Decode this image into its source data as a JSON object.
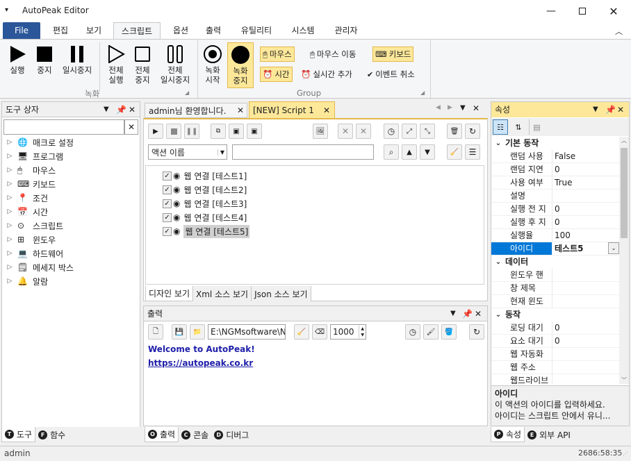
{
  "app": {
    "title": "AutoPeak Editor"
  },
  "ribbon_tabs": [
    {
      "label": "File"
    },
    {
      "label": "편집"
    },
    {
      "label": "보기"
    },
    {
      "label": "스크립트"
    },
    {
      "label": "옵션"
    },
    {
      "label": "출력"
    },
    {
      "label": "유틸리티"
    },
    {
      "label": "시스템"
    },
    {
      "label": "관리자"
    }
  ],
  "ribbon": {
    "record_buttons": [
      {
        "label": "실행"
      },
      {
        "label": "중지"
      },
      {
        "label": "일시중지"
      }
    ],
    "all_buttons": [
      {
        "label": "전체\n실행"
      },
      {
        "label": "전체\n중지"
      },
      {
        "label": "전체\n일시중지"
      }
    ],
    "rec_buttons": [
      {
        "label": "녹화\n시작"
      },
      {
        "label": "녹화\n중지"
      }
    ],
    "group_items": {
      "mouse_click": "마우스",
      "mouse_move": "마우스 이동",
      "keyboard": "키보드",
      "time": "시간",
      "realtime_add": "실시간 추가",
      "event_cancel": "이벤트 취소"
    },
    "group_labels": {
      "record": "녹화",
      "group": "Group"
    }
  },
  "toolbox": {
    "title": "도구 상자",
    "search_value": "",
    "items": [
      {
        "label": "매크로 설정"
      },
      {
        "label": "프로그램"
      },
      {
        "label": "마우스"
      },
      {
        "label": "키보드"
      },
      {
        "label": "조건"
      },
      {
        "label": "시간"
      },
      {
        "label": "스크립트"
      },
      {
        "label": "윈도우"
      },
      {
        "label": "하드웨어"
      },
      {
        "label": "메세지 박스"
      },
      {
        "label": "알람"
      }
    ],
    "bottom_tabs": [
      {
        "label": "도구",
        "key": "T"
      },
      {
        "label": "함수",
        "key": "F"
      }
    ]
  },
  "doc_tabs": [
    {
      "label": "admin님 환영합니다."
    },
    {
      "label": "[NEW] Script 1"
    }
  ],
  "script": {
    "action_select": "액션 이름",
    "filter_value": "",
    "items": [
      {
        "label": "웹 연결 [테스트1]"
      },
      {
        "label": "웹 연결 [테스트2]"
      },
      {
        "label": "웹 연결 [테스트3]"
      },
      {
        "label": "웹 연결 [테스트4]"
      },
      {
        "label": "웹 연결 [테스트5]"
      }
    ],
    "view_tabs": [
      {
        "label": "디자인 보기"
      },
      {
        "label": "Xml 소스 보기"
      },
      {
        "label": "Json 소스 보기"
      }
    ]
  },
  "output": {
    "title": "출력",
    "path": "E:\\NGMsoftware\\NG",
    "count": "1000",
    "lines": [
      "Welcome to AutoPeak!",
      "https://autopeak.co.kr"
    ],
    "bottom_tabs": [
      {
        "label": "출력",
        "key": "O"
      },
      {
        "label": "콘솔",
        "key": "C"
      },
      {
        "label": "디버그",
        "key": "D"
      }
    ]
  },
  "properties": {
    "title": "속성",
    "categories": [
      {
        "name": "기본 동작",
        "rows": [
          {
            "k": "랜덤 사용",
            "v": "False"
          },
          {
            "k": "랜덤 지연",
            "v": "0"
          },
          {
            "k": "사용 여부",
            "v": "True"
          },
          {
            "k": "설명",
            "v": ""
          },
          {
            "k": "실행 전 지",
            "v": "0"
          },
          {
            "k": "실행 후 지",
            "v": "0"
          },
          {
            "k": "실행율",
            "v": "100"
          },
          {
            "k": "아이디",
            "v": "테스트5"
          }
        ]
      },
      {
        "name": "데이터",
        "rows": [
          {
            "k": "윈도우 핸",
            "v": ""
          },
          {
            "k": "창 제목",
            "v": ""
          },
          {
            "k": "현재 윈도",
            "v": ""
          }
        ]
      },
      {
        "name": "동작",
        "rows": [
          {
            "k": "로딩 대기",
            "v": "0"
          },
          {
            "k": "요소 대기",
            "v": "0"
          },
          {
            "k": "웹 자동화",
            "v": ""
          },
          {
            "k": "웹 주소",
            "v": ""
          },
          {
            "k": "웹드라이브",
            "v": ""
          }
        ]
      }
    ],
    "desc_title": "아이디",
    "desc_lines": [
      "이 액션의 아이디를 입력하세요.",
      "아이디는 스크립트 안에서 유니..."
    ],
    "bottom_tabs": [
      {
        "label": "속성",
        "key": "P"
      },
      {
        "label": "외부 API",
        "key": "E"
      }
    ]
  },
  "status": {
    "user": "admin",
    "time": "2686:58:35"
  },
  "colors": {
    "accent": "#2b579a",
    "highlight": "#fde89a",
    "selected": "#d0d0d0",
    "link": "#1e1eaa"
  }
}
